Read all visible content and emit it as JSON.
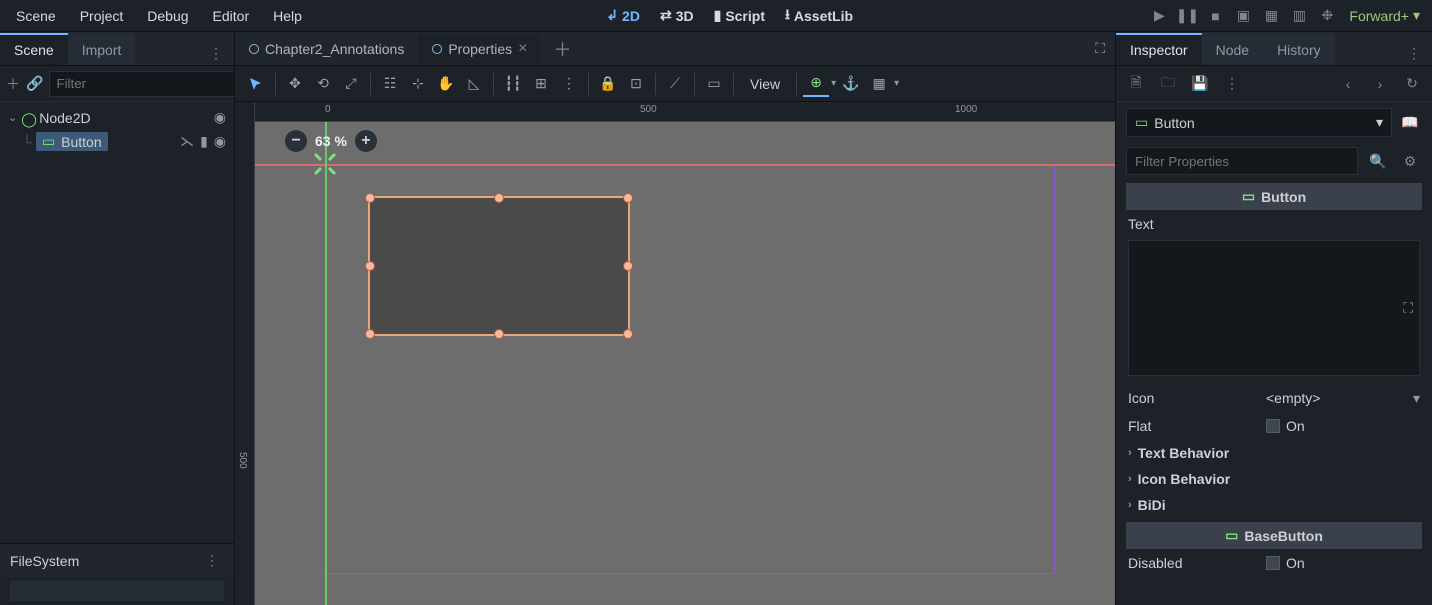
{
  "menu": {
    "scene": "Scene",
    "project": "Project",
    "debug": "Debug",
    "editor": "Editor",
    "help": "Help"
  },
  "modes": {
    "m2d": "2D",
    "m3d": "3D",
    "script": "Script",
    "assetlib": "AssetLib"
  },
  "render_mode": "Forward+",
  "left": {
    "tabs": {
      "scene": "Scene",
      "import": "Import"
    },
    "filter_placeholder": "Filter",
    "root": "Node2D",
    "child": "Button",
    "filesystem": "FileSystem"
  },
  "center": {
    "tab1": "Chapter2_Annotations",
    "tab2": "Properties",
    "view": "View",
    "zoom": "63 %",
    "ruler_h": {
      "t0": "0",
      "t500": "500",
      "t1000": "1000"
    },
    "ruler_v": {
      "t500": "500"
    }
  },
  "right": {
    "tabs": {
      "inspector": "Inspector",
      "node": "Node",
      "history": "History"
    },
    "obj": "Button",
    "filter_placeholder": "Filter Properties",
    "section_button": "Button",
    "text_label": "Text",
    "icon_label": "Icon",
    "icon_value": "<empty>",
    "flat_label": "Flat",
    "flat_value": "On",
    "group_text_behavior": "Text Behavior",
    "group_icon_behavior": "Icon Behavior",
    "group_bidi": "BiDi",
    "section_basebutton": "BaseButton",
    "disabled_label": "Disabled",
    "disabled_value": "On"
  }
}
